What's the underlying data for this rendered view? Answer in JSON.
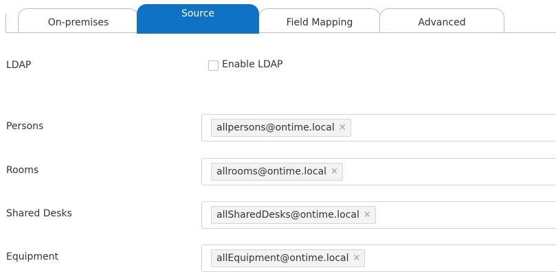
{
  "tabs": {
    "onprem": "On-premises",
    "source": "Source",
    "field_mapping": "Field Mapping",
    "advanced": "Advanced"
  },
  "ldap": {
    "label": "LDAP",
    "checkbox_label": "Enable LDAP",
    "checked": false
  },
  "rows": {
    "persons": {
      "label": "Persons",
      "value": "allpersons@ontime.local"
    },
    "rooms": {
      "label": "Rooms",
      "value": "allrooms@ontime.local"
    },
    "shared_desks": {
      "label": "Shared Desks",
      "value": "allSharedDesks@ontime.local"
    },
    "equipment": {
      "label": "Equipment",
      "value": "allEquipment@ontime.local"
    }
  },
  "icons": {
    "chip_remove": "×"
  },
  "colors": {
    "active_tab": "#0f72c5",
    "border": "#d3d3d3",
    "chip_bg": "#f3f3f3"
  }
}
